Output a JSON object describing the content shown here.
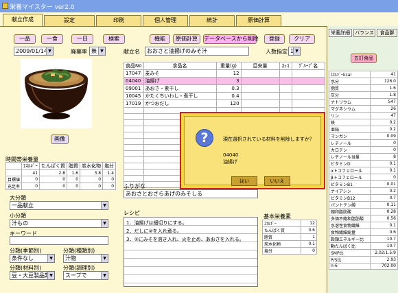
{
  "window": {
    "title": "栄養マイスター ver2.0"
  },
  "tabs": [
    "献立作成",
    "設定",
    "印刷",
    "個人管理",
    "統計",
    "原価計算"
  ],
  "toolbar": {
    "b_ippin": "一品",
    "b_ikkon": "一食",
    "b_ichinichi": "一日",
    "b_search": "検索",
    "b_kinou": "機能",
    "b_genka": "原価計算",
    "b_delete": "データベースから削除",
    "b_touroku": "登録",
    "b_clear": "クリア"
  },
  "date": {
    "value": "2009/01/14"
  },
  "haikiritsu": {
    "label": "廃棄率",
    "value": "無"
  },
  "kondate": {
    "label": "献立名",
    "value": "おおさと油揚げのみそ汁"
  },
  "ninzu": {
    "label": "人数指定",
    "value": "1"
  },
  "food_table": {
    "headers": [
      "食品No",
      "食品名",
      "重量(g)",
      "目安量",
      "ｶｯｺ",
      "ｸﾞﾙｰﾌﾟ名"
    ],
    "rows": [
      [
        "17047",
        "麦みそ",
        "12"
      ],
      [
        "04040",
        "油揚げ",
        "3"
      ],
      [
        "09001",
        "あおさ・素干し",
        "0.3"
      ],
      [
        "10045",
        "かたくちいわし・煮干し",
        "0.4"
      ],
      [
        "17019",
        "かつおだし",
        "120"
      ]
    ]
  },
  "image_button": "画像",
  "nutri": {
    "title": "時間帯栄養量",
    "headers": [
      "ｴﾈﾙｷﾞｰ",
      "たんぱく質",
      "脂質",
      "炭水化物",
      "塩分"
    ],
    "rows": [
      {
        "label": "",
        "vals": [
          "41",
          "2.8",
          "1.6",
          "3.8",
          "1.4"
        ]
      },
      {
        "label": "目標値",
        "vals": [
          "0",
          "0",
          "0",
          "0",
          "0"
        ]
      },
      {
        "label": "充足率",
        "vals": [
          "0",
          "0",
          "0",
          "0",
          "0"
        ]
      }
    ]
  },
  "daibunrui": {
    "label": "大分類",
    "value": "一品献立"
  },
  "shobunrui": {
    "label": "小分類",
    "value": "汁もの"
  },
  "keyword": {
    "label": "キーワード",
    "value": ""
  },
  "bunrui_kisetsu": {
    "label": "分類(季節別)",
    "value": "条件なし"
  },
  "bunrui_shurui": {
    "label": "分類(種類別)",
    "value": "汁物"
  },
  "bunrui_zairyo": {
    "label": "分類(材料別)",
    "value": "豆・大豆製品類"
  },
  "bunrui_chori": {
    "label": "分類(調理別)",
    "value": "スープで"
  },
  "furigana": {
    "label": "ふりがな",
    "value": "あおさとおさらあげのみそしる"
  },
  "recipe": {
    "label": "レシピ",
    "lines": [
      "1．油揚げは細切りにする。",
      "2．だしに②を入れ煮る。",
      "3．②にみそを溶き入れ、火を止め、あおさを入れる。"
    ]
  },
  "kihon": {
    "title": "基本栄養素",
    "rows": [
      [
        "ｴﾈﾙｷﾞｰ",
        "12"
      ],
      [
        "たんぱく質",
        "0.6"
      ],
      [
        "脂質",
        "1"
      ],
      [
        "炭水化物",
        "0.1"
      ],
      [
        "塩分",
        "0"
      ]
    ]
  },
  "right_panel": {
    "tabs": [
      "栄養詳細",
      "バランス",
      "食品群"
    ],
    "badge": "五訂食品",
    "rows": [
      [
        "ｴﾈﾙｷﾞｰkcal",
        "41"
      ],
      [
        "水分",
        "126.0"
      ],
      [
        "脂質",
        "1.6"
      ],
      [
        "灰分",
        "1.8"
      ],
      [
        "ナトリウム",
        "547"
      ],
      [
        "マグネシウム",
        "26"
      ],
      [
        "リン",
        "47"
      ],
      [
        "鉄",
        "0.2"
      ],
      [
        "亜鉛",
        "0.2"
      ],
      [
        "マンガン",
        "0.09"
      ],
      [
        "レチノール",
        "0"
      ],
      [
        "カロテン",
        "0"
      ],
      [
        "レチノール当量",
        "8"
      ],
      [
        "ビタミンD",
        "0.1"
      ],
      [
        "αトコフェロール",
        "0.1"
      ],
      [
        "βトコフェロール",
        "0"
      ],
      [
        "ビタミンB1",
        "0.01"
      ],
      [
        "ナイアシン",
        "0.2"
      ],
      [
        "ビタミンB12",
        "0.7"
      ],
      [
        "パントテン酸",
        "0.11"
      ],
      [
        "飽和脂肪酸",
        "0.28"
      ],
      [
        "多価不飽和脂肪酸",
        "0.56"
      ],
      [
        "水溶性食物繊維",
        "0.1"
      ],
      [
        "食物繊維総量",
        "0.6"
      ],
      [
        "穀類エネルギー比",
        "10.7"
      ],
      [
        "動たんぱく比",
        "10.7"
      ],
      [
        "SMP比",
        "2.02:1.5:9"
      ],
      [
        "P/S比",
        "2.93"
      ],
      [
        "n-6",
        "702.00"
      ]
    ]
  },
  "dialog": {
    "message": "現在選択されている材料を削除しますか？",
    "code": "04040",
    "name": "油揚げ",
    "yes": "はい",
    "no": "いいえ"
  },
  "colors": {
    "accent": "#d02020",
    "tab_bg": "#f7e08a",
    "panel_bg": "#fdf8d2"
  }
}
